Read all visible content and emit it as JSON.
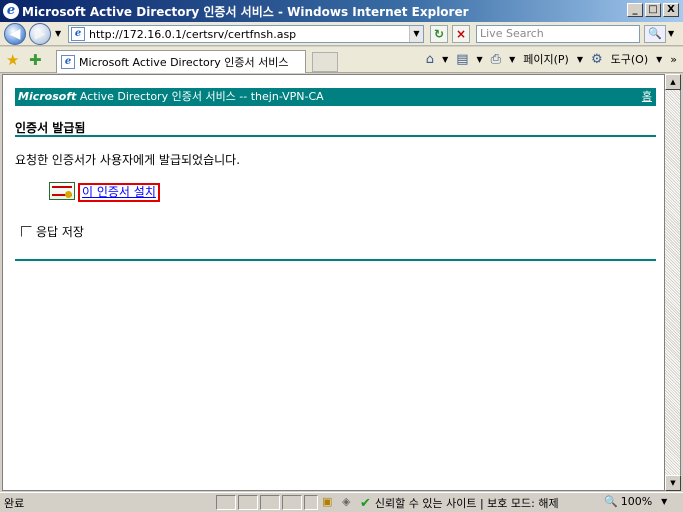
{
  "window": {
    "title": "Microsoft Active Directory 인증서 서비스 - Windows Internet Explorer",
    "minimize": "_",
    "maximize": "□",
    "close": "X"
  },
  "address_bar": {
    "url": "http://172.16.0.1/certsrv/certfnsh.asp",
    "search_placeholder": "Live Search"
  },
  "tab": {
    "title": "Microsoft Active Directory 인증서 서비스"
  },
  "command_bar": {
    "page_menu": "페이지(P)",
    "tools_menu": "도구(O)"
  },
  "page": {
    "banner_brand": "Microsoft",
    "banner_text": " Active Directory 인증서 서비스  --  thejn-VPN-CA",
    "home_link": "홈",
    "heading": "인증서 발급됨",
    "message": "요청한 인증서가 사용자에게 발급되었습니다.",
    "install_link": "이 인증서 설치",
    "save_response_label": "응답 저장"
  },
  "status_bar": {
    "status": "완료",
    "zone": "신뢰할 수 있는 사이트 | 보호 모드: 해제",
    "zoom": "100%"
  }
}
